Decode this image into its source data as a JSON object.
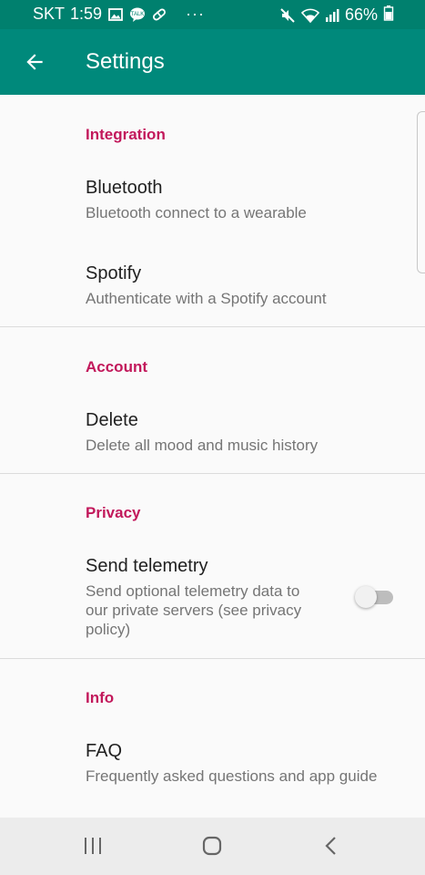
{
  "status": {
    "carrier": "SKT",
    "time": "1:59",
    "more": "···",
    "battery": "66%"
  },
  "app_bar": {
    "title": "Settings",
    "back_icon": "arrow-left-icon"
  },
  "sections": {
    "integration": {
      "header": "Integration",
      "bluetooth": {
        "title": "Bluetooth",
        "summary": "Bluetooth connect to a wearable"
      },
      "spotify": {
        "title": "Spotify",
        "summary": "Authenticate with a Spotify account"
      }
    },
    "account": {
      "header": "Account",
      "delete": {
        "title": "Delete",
        "summary": "Delete all mood and music history"
      }
    },
    "privacy": {
      "header": "Privacy",
      "telemetry": {
        "title": "Send telemetry",
        "summary_line1": "Send optional telemetry data to",
        "summary_line2": "our private servers (see privacy",
        "summary_line3": "policy)",
        "enabled": false
      }
    },
    "info": {
      "header": "Info",
      "faq": {
        "title": "FAQ",
        "summary": "Frequently asked questions and app guide"
      }
    }
  },
  "colors": {
    "status_bar": "#00806e",
    "app_bar": "#00897b",
    "category": "#c2185b",
    "background": "#fafafa",
    "nav_bar": "#ececec"
  },
  "nav": {
    "recents_icon": "recent-apps-icon",
    "home_icon": "home-icon",
    "back_icon": "back-chevron-icon"
  }
}
